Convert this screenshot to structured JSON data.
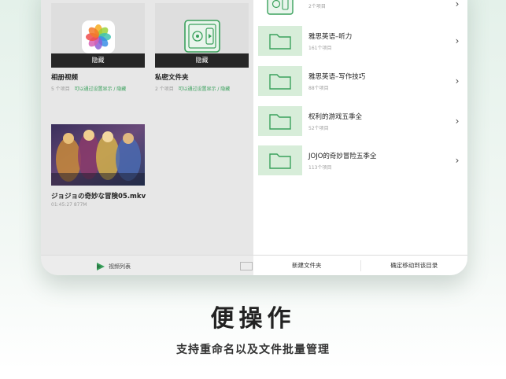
{
  "left_pane": {
    "album_card": {
      "hide_label": "隐藏",
      "title": "相册视频",
      "count": "5 个项目",
      "hint": "可以通过设置显示 / 隐藏"
    },
    "private_card": {
      "hide_label": "隐藏",
      "title": "私密文件夹",
      "count": "2 个项目",
      "hint": "可以通过设置显示 / 隐藏"
    },
    "video": {
      "title": "ジョジョの奇妙な冒険05.mkv",
      "meta": "01:45:27   877M"
    }
  },
  "right_pane": {
    "folders": [
      {
        "name": "",
        "count": "2个项目"
      },
      {
        "name": "雅思英语–听力",
        "count": "161个项目"
      },
      {
        "name": "雅思英语–写作技巧",
        "count": "88个项目"
      },
      {
        "name": "权利的游戏五季全",
        "count": "52个项目"
      },
      {
        "name": "JOJO的奇妙冒险五季全",
        "count": "113个项目"
      }
    ]
  },
  "bottom_bar": {
    "tab_video_list": "视频列表",
    "new_folder": "新建文件夹",
    "confirm_move": "确定移动到该目录"
  },
  "promo": {
    "headline": "便操作",
    "subtitle": "支持重命名以及文件批量管理"
  },
  "colors": {
    "accent_green": "#3aa15c",
    "folder_bg": "#d7edd9"
  }
}
